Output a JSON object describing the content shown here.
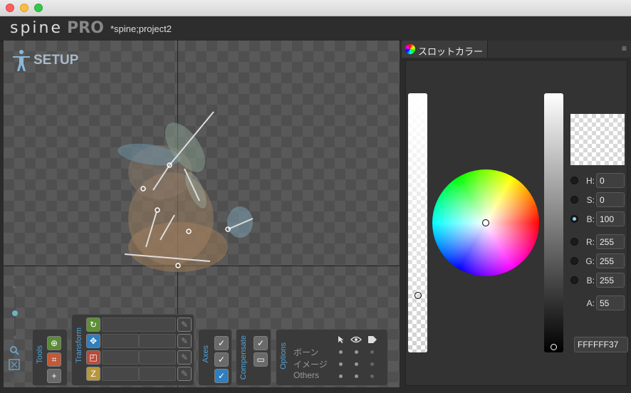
{
  "window": {
    "title": ""
  },
  "app": {
    "logo_text": "spine",
    "logo_edition": "PRO",
    "project_title": "*spine;project2"
  },
  "viewport": {
    "mode_label": "SETUP"
  },
  "toolbar": {
    "tools_label": "Tools",
    "transform_label": "Transform",
    "axes_label": "Axes",
    "compensate_label": "Compensate",
    "options_label": "Options",
    "options_rows": [
      "ボーン",
      "イメージ",
      "Others"
    ]
  },
  "color_panel": {
    "tab_label": "スロットカラー",
    "fields": [
      {
        "label": "H:",
        "value": "0"
      },
      {
        "label": "S:",
        "value": "0"
      },
      {
        "label": "B:",
        "value": "100"
      },
      {
        "label": "R:",
        "value": "255"
      },
      {
        "label": "G:",
        "value": "255"
      },
      {
        "label": "B:",
        "value": "255"
      },
      {
        "label": "A:",
        "value": "55"
      }
    ],
    "selected_mode": "B",
    "hex": "FFFFFF37",
    "alpha_fraction": 0.215
  },
  "colors": {
    "accent": "#4fa3d9",
    "viewport_bg": "#595959",
    "panel_bg": "#333333"
  },
  "icons": [
    "spine-figure-icon",
    "zoom-icon",
    "fit-icon",
    "lock-icon",
    "rotate-icon",
    "translate-icon",
    "scale-icon",
    "shear-icon",
    "pointer-icon",
    "eye-icon",
    "tag-icon",
    "color-wheel-icon",
    "menu-icon"
  ]
}
